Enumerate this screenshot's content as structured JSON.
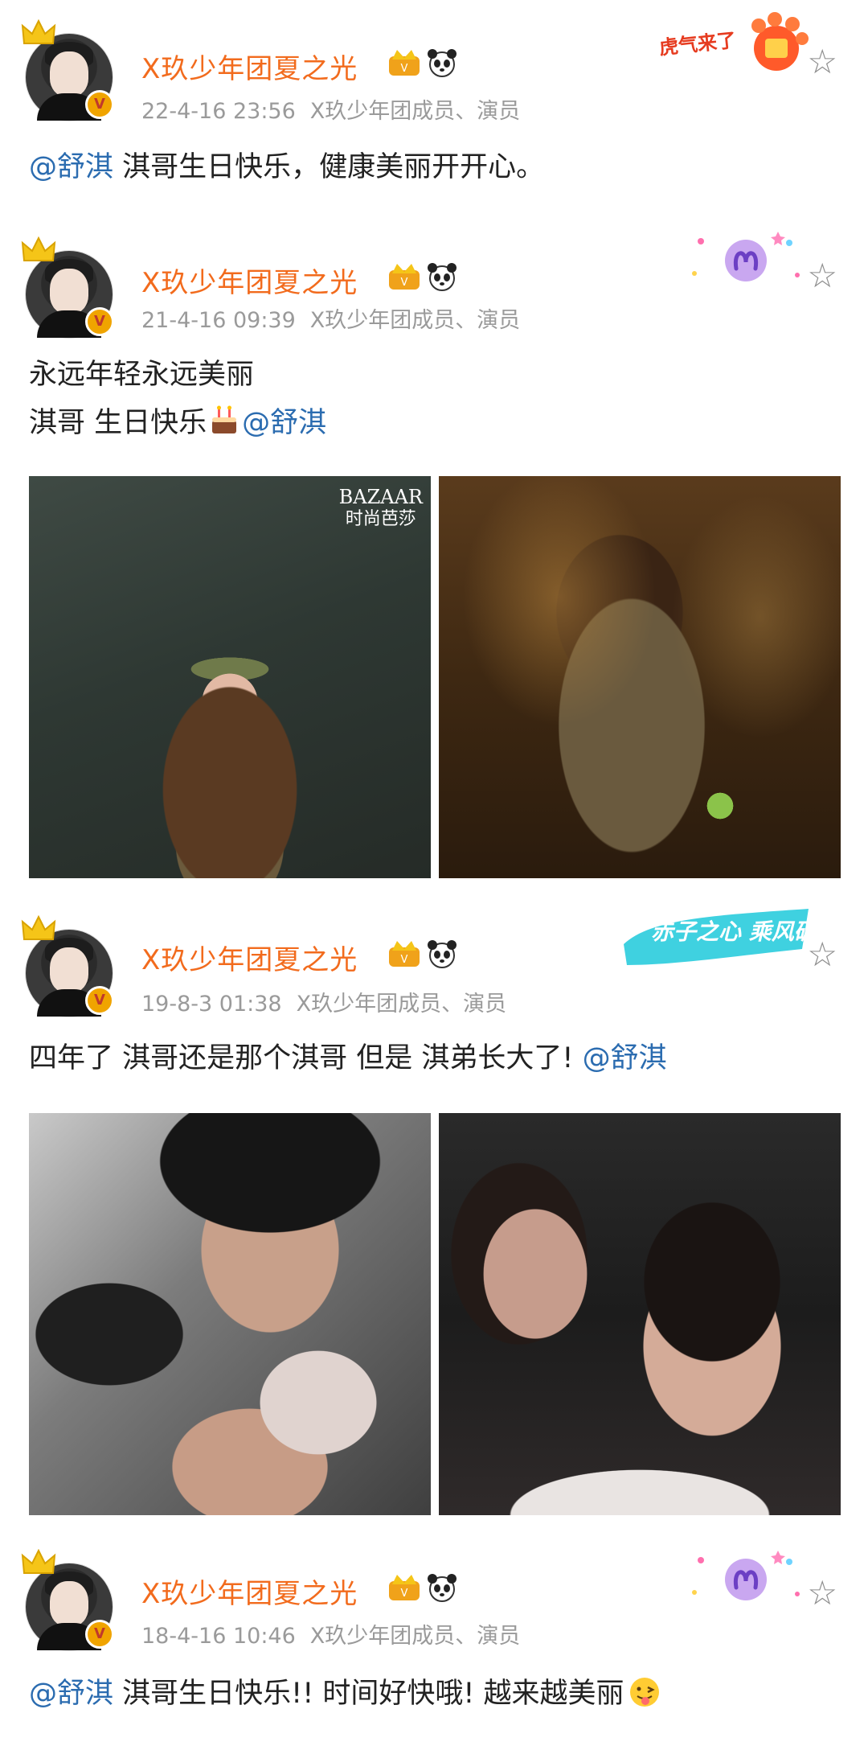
{
  "posts": [
    {
      "author": "X玖少年团夏之光",
      "time": "22-4-16 23:56",
      "source": "X玖少年团成员、演员",
      "mention": "@舒淇",
      "body": "淇哥生日快乐，健康美丽开开心。",
      "decoration": "虎气来了",
      "decoration_icon": "paw-badge"
    },
    {
      "author": "X玖少年团夏之光",
      "time": "21-4-16 09:39",
      "source": "X玖少年团成员、演员",
      "line1": "永远年轻永远美丽",
      "line2": "淇哥 生日快乐",
      "mention": "@舒淇",
      "emoji": "cake-icon",
      "decoration_icon": "aries-sign",
      "image_watermark_1": "BAZAAR",
      "image_watermark_2": "时尚芭莎"
    },
    {
      "author": "X玖少年团夏之光",
      "time": "19-8-3 01:38",
      "source": "X玖少年团成员、演员",
      "body": "四年了 淇哥还是那个淇哥 但是 淇弟长大了!",
      "mention": "@舒淇",
      "decoration": "赤子之心 乘风破浪"
    },
    {
      "author": "X玖少年团夏之光",
      "time": "18-4-16 10:46",
      "source": "X玖少年团成员、演员",
      "mention": "@舒淇",
      "body": "淇哥生日快乐!! 时间好快哦! 越来越美丽",
      "emoji": "tongue-face-icon",
      "decoration_icon": "aries-sign"
    }
  ],
  "icons": {
    "star": "☆",
    "verified": "V"
  },
  "colors": {
    "username": "#f26b1d",
    "mention": "#2b6cb0",
    "meta": "#9a9a9a"
  }
}
